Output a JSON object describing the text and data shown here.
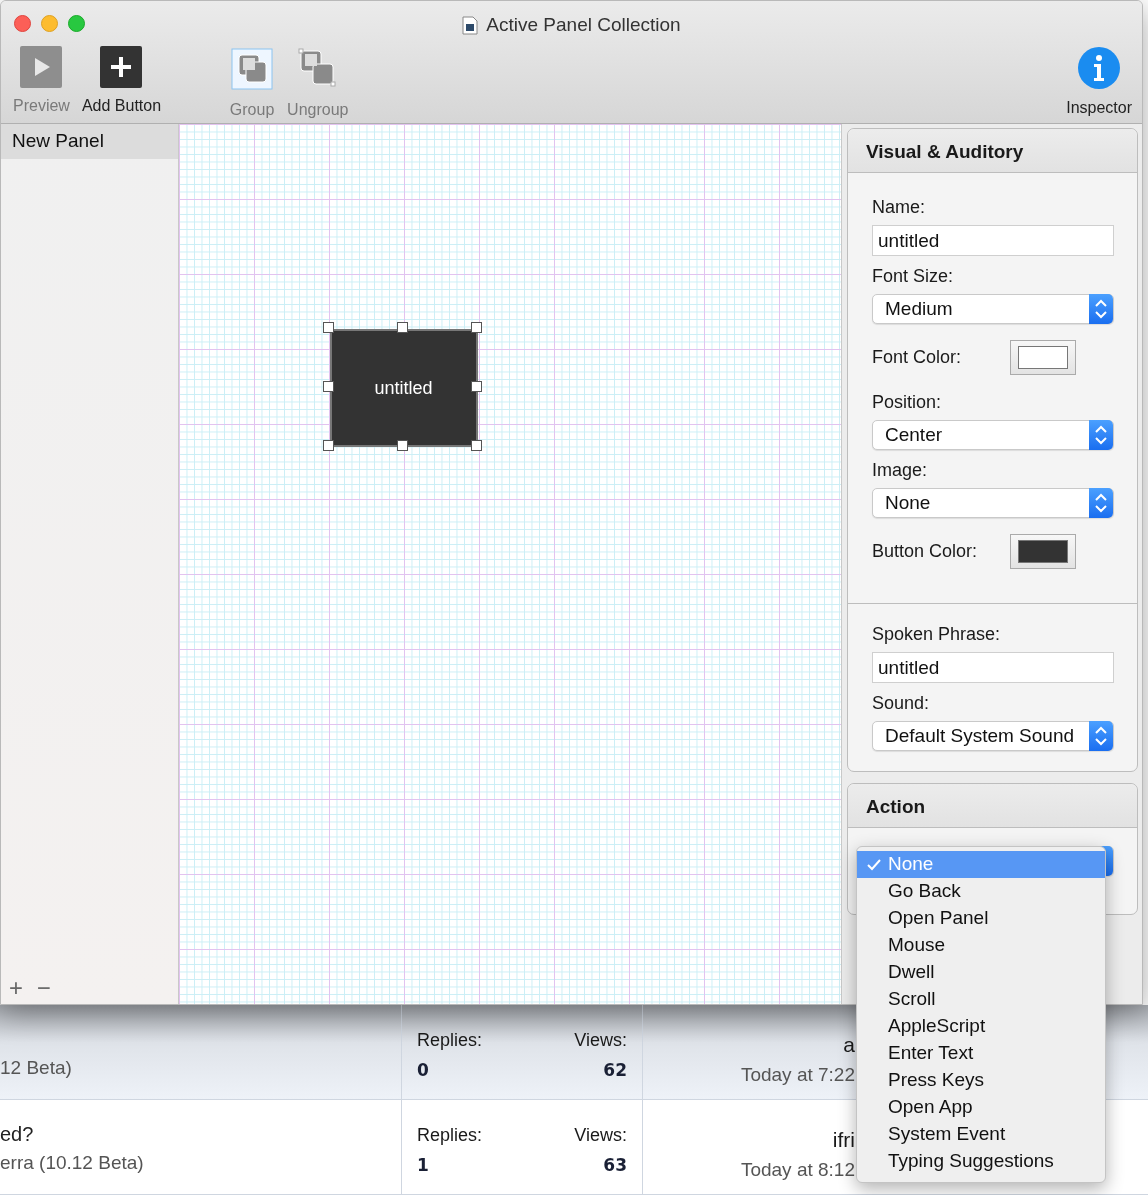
{
  "window": {
    "title": "Active Panel Collection"
  },
  "toolbar": [
    {
      "kind": "preview",
      "label": "Preview",
      "disabled": true
    },
    {
      "kind": "add",
      "label": "Add Button",
      "disabled": false
    },
    {
      "kind": "group",
      "label": "Group",
      "disabled": true
    },
    {
      "kind": "ungroup",
      "label": "Ungroup",
      "disabled": true
    },
    {
      "kind": "inspector",
      "label": "Inspector",
      "disabled": false
    }
  ],
  "sidebar": {
    "items": [
      {
        "label": "New Panel",
        "selected": true
      }
    ],
    "add": "+",
    "remove": "−"
  },
  "canvas": {
    "buttons": [
      {
        "label": "untitled",
        "selected": true
      }
    ]
  },
  "inspector": {
    "sections": [
      {
        "title": "Visual & Auditory",
        "groups": [
          [
            {
              "kind": "text",
              "label": "Name:",
              "value": "untitled"
            },
            {
              "kind": "popup",
              "label": "Font Size:",
              "value": "Medium"
            },
            {
              "kind": "color",
              "label": "Font Color:",
              "color": "#ffffff"
            },
            {
              "kind": "popup",
              "label": "Position:",
              "value": "Center"
            },
            {
              "kind": "popup",
              "label": "Image:",
              "value": "None"
            },
            {
              "kind": "color",
              "label": "Button Color:",
              "color": "#333333"
            }
          ],
          [
            {
              "kind": "text",
              "label": "Spoken Phrase:",
              "value": "untitled"
            },
            {
              "kind": "popup",
              "label": "Sound:",
              "value": "Default System Sound"
            }
          ]
        ]
      },
      {
        "title": "Action",
        "groups": [
          [
            {
              "kind": "popup"
            }
          ]
        ]
      }
    ]
  },
  "action_menu": [
    {
      "label": "None",
      "selected": true
    },
    {
      "label": "Go Back",
      "selected": false
    },
    {
      "label": "Open Panel",
      "selected": false
    },
    {
      "label": "Mouse",
      "selected": false
    },
    {
      "label": "Dwell",
      "selected": false
    },
    {
      "label": "Scroll",
      "selected": false
    },
    {
      "label": "AppleScript",
      "selected": false
    },
    {
      "label": "Enter Text",
      "selected": false
    },
    {
      "label": "Press Keys",
      "selected": false
    },
    {
      "label": "Open App",
      "selected": false
    },
    {
      "label": "System Event",
      "selected": false
    },
    {
      "label": "Typing Suggestions",
      "selected": false
    }
  ],
  "background_page": {
    "rows": [
      {
        "highlighted": true,
        "subtitle": "12 Beta)",
        "replies_label": "Replies:",
        "replies": "0",
        "views_label": "Views:",
        "views": "62",
        "author": "a",
        "time": "Today at 7:22"
      },
      {
        "highlighted": false,
        "title": "ed?",
        "subtitle": "erra (10.12 Beta)",
        "replies_label": "Replies:",
        "replies": "1",
        "views_label": "Views:",
        "views": "63",
        "author": "ifri",
        "time": "Today at 8:12"
      }
    ]
  }
}
